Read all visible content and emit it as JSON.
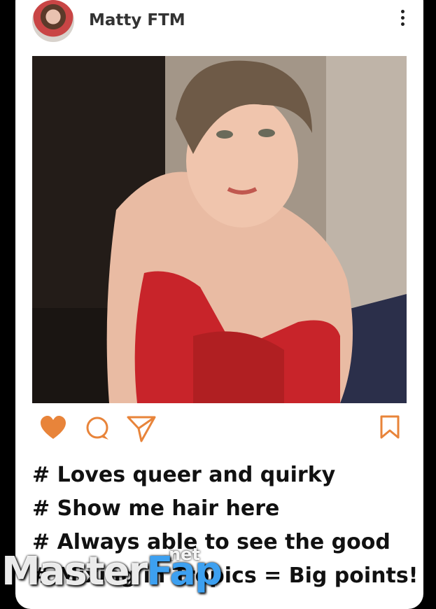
{
  "post": {
    "username": "Matty FTM",
    "menu_icon": "kebab-menu-icon",
    "photo_alt": "post-photo",
    "actions": {
      "like_icon": "heart-icon",
      "comment_icon": "comment-icon",
      "share_icon": "send-icon",
      "save_icon": "bookmark-icon"
    },
    "caption_lines": [
      "# Loves queer and quirky",
      "# Show me hair here",
      "# Always able to see the good",
      "# Mixing in Tropics = Big points!"
    ]
  },
  "watermark": {
    "main": "Master",
    "accent": "Fap",
    "suffix": ".net"
  },
  "colors": {
    "accent": "#e8843a",
    "like": "#e8843a",
    "watermark_accent": "#3da0f0"
  }
}
